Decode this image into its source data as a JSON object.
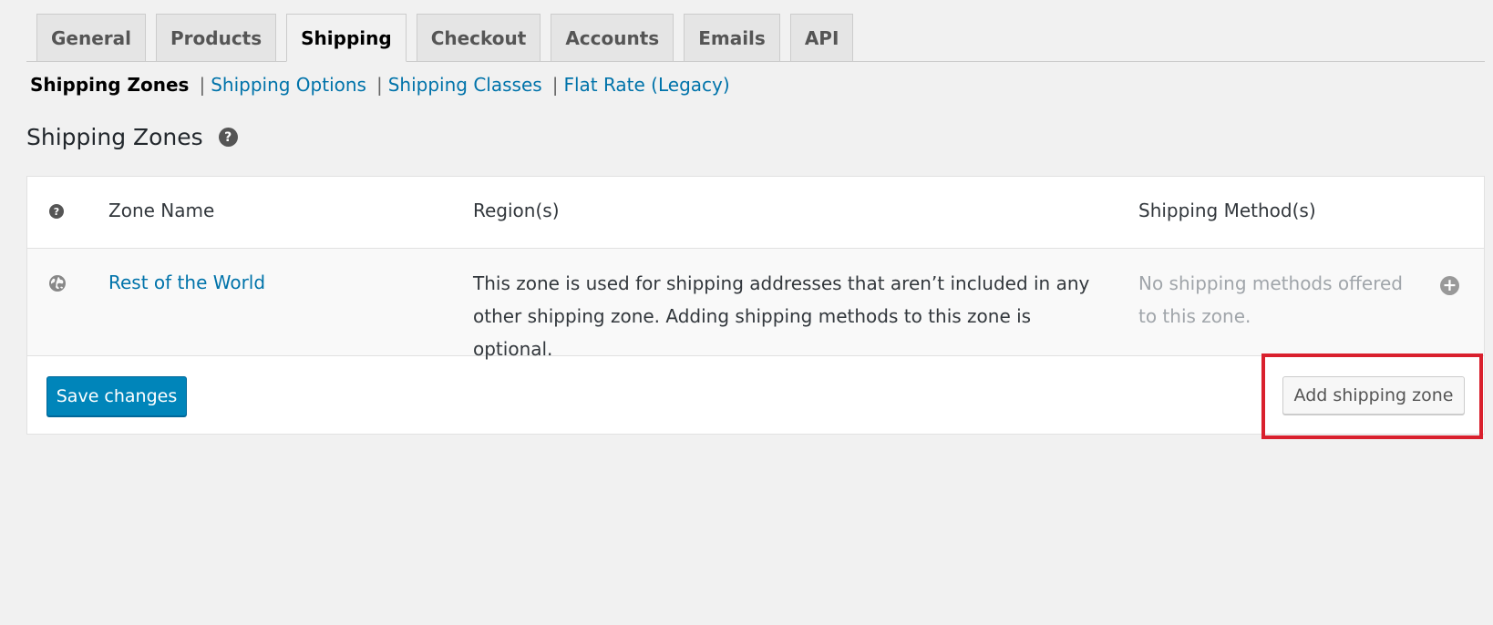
{
  "tabs": [
    {
      "label": "General",
      "active": false
    },
    {
      "label": "Products",
      "active": false
    },
    {
      "label": "Shipping",
      "active": true
    },
    {
      "label": "Checkout",
      "active": false
    },
    {
      "label": "Accounts",
      "active": false
    },
    {
      "label": "Emails",
      "active": false
    },
    {
      "label": "API",
      "active": false
    }
  ],
  "subnav": {
    "current": "Shipping Zones",
    "separator": "|",
    "links": [
      "Shipping Options",
      "Shipping Classes",
      "Flat Rate (Legacy)"
    ]
  },
  "heading": {
    "title": "Shipping Zones",
    "help_glyph": "?"
  },
  "table": {
    "headers": {
      "help_glyph": "?",
      "zone_name": "Zone Name",
      "regions": "Region(s)",
      "methods": "Shipping Method(s)"
    },
    "rows": [
      {
        "icon": "globe-icon",
        "zone_name": "Rest of the World",
        "region_line1": "This zone is used for shipping addresses that aren’t included in any",
        "region_line2": "other shipping zone. Adding shipping methods to this zone is optional.",
        "methods_line1": "No shipping methods offered",
        "methods_line2": "to this zone.",
        "add_glyph": "+"
      }
    ]
  },
  "footer": {
    "save_label": "Save changes",
    "add_zone_label": "Add shipping zone"
  },
  "colors": {
    "accent": "#0073aa",
    "primary_button": "#0085ba",
    "highlight": "#d9202d",
    "background": "#f1f1f1"
  }
}
